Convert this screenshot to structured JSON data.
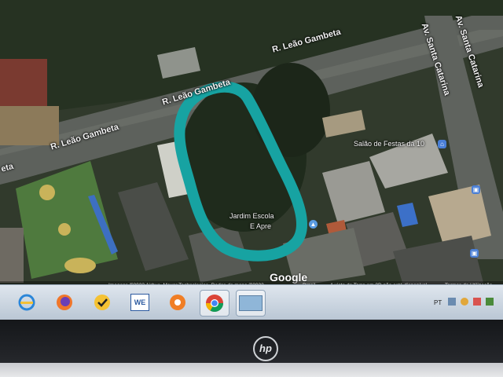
{
  "map": {
    "streets": [
      {
        "id": "leao-top",
        "label": "R. Leão Gambeta"
      },
      {
        "id": "leao-mid",
        "label": "R. Leão Gambeta"
      },
      {
        "id": "leao-left",
        "label": "R. Leão Gambeta"
      },
      {
        "id": "santa1",
        "label": "Av. Santa Catarina"
      },
      {
        "id": "santa2",
        "label": "Av. Santa Catarina"
      },
      {
        "id": "edge",
        "label": "eta"
      }
    ],
    "places": [
      {
        "id": "salao",
        "label": "Salão de Festas da 10"
      },
      {
        "id": "escola1",
        "label": "Jardim Escola"
      },
      {
        "id": "escola2",
        "label": "E Apre"
      }
    ],
    "logo": "Google",
    "attribution": "Imagens ©2023 Airbus, Maxar Technologies, Dados do mapa ©2023",
    "country": "Brasil",
    "note": "A vista de Terra em 3D não está disponível",
    "terms": "Termos de Utilização",
    "highlight_color": "#17a3a2"
  },
  "taskbar": {
    "apps": [
      {
        "name": "internet-explorer",
        "label": ""
      },
      {
        "name": "firefox",
        "label": ""
      },
      {
        "name": "norton",
        "label": ""
      },
      {
        "name": "word",
        "label": "WE"
      },
      {
        "name": "avast",
        "label": ""
      },
      {
        "name": "chrome",
        "label": ""
      },
      {
        "name": "maps-window",
        "label": ""
      }
    ],
    "tray_language": "PT"
  },
  "device": {
    "brand": "hp"
  }
}
